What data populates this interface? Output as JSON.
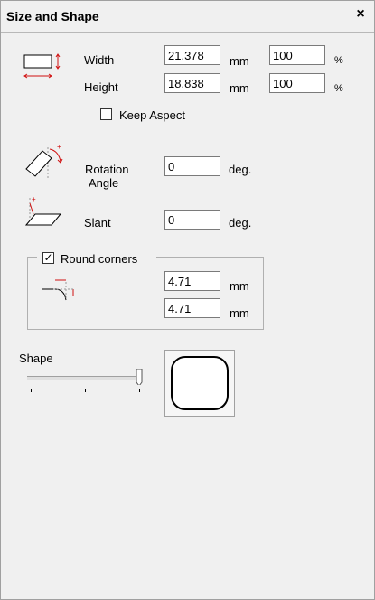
{
  "window": {
    "title": "Size and Shape",
    "close_glyph": "×"
  },
  "size": {
    "width_label": "Width",
    "width_access": "W",
    "width_value": "21.378",
    "width_unit": "mm",
    "width_percent": "100",
    "height_label": "Height",
    "height_access": "H",
    "height_value": "18.838",
    "height_unit": "mm",
    "height_percent": "100",
    "percent_unit": "%",
    "keep_aspect_label": "Keep Aspect",
    "keep_aspect_checked": false
  },
  "rotation": {
    "label_line1": "Rotation",
    "label_line2": "Angle",
    "value": "0",
    "unit": "deg."
  },
  "slant": {
    "label": "Slant",
    "value": "0",
    "unit": "deg."
  },
  "round_corners": {
    "label": "Round corners",
    "checked": true,
    "horizontal_value": "4.71",
    "vertical_value": "4.71",
    "unit": "mm"
  },
  "shape": {
    "label": "Shape",
    "slider_position": 1.0
  },
  "colors": {
    "accent_red": "#d01010",
    "border": "#7a7a7a",
    "panel_bg": "#f0f0f0"
  },
  "icons": [
    "size-rectangle-icon",
    "rotation-icon",
    "slant-icon",
    "corner-radius-icon"
  ]
}
